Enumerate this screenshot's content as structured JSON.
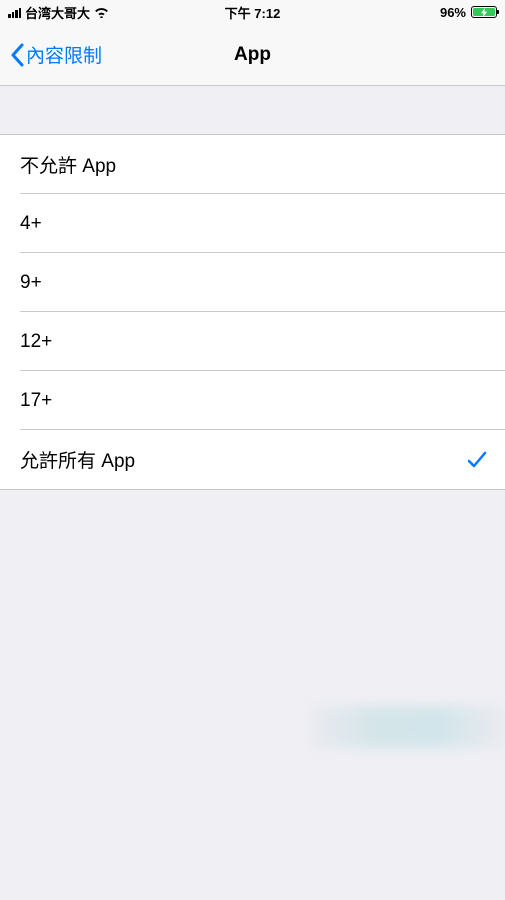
{
  "statusBar": {
    "carrier": "台湾大哥大",
    "time": "下午 7:12",
    "batteryPercent": "96%"
  },
  "nav": {
    "backLabel": "內容限制",
    "title": "App"
  },
  "options": [
    {
      "label": "不允許 App",
      "selected": false
    },
    {
      "label": "4+",
      "selected": false
    },
    {
      "label": "9+",
      "selected": false
    },
    {
      "label": "12+",
      "selected": false
    },
    {
      "label": "17+",
      "selected": false
    },
    {
      "label": "允許所有 App",
      "selected": true
    }
  ]
}
